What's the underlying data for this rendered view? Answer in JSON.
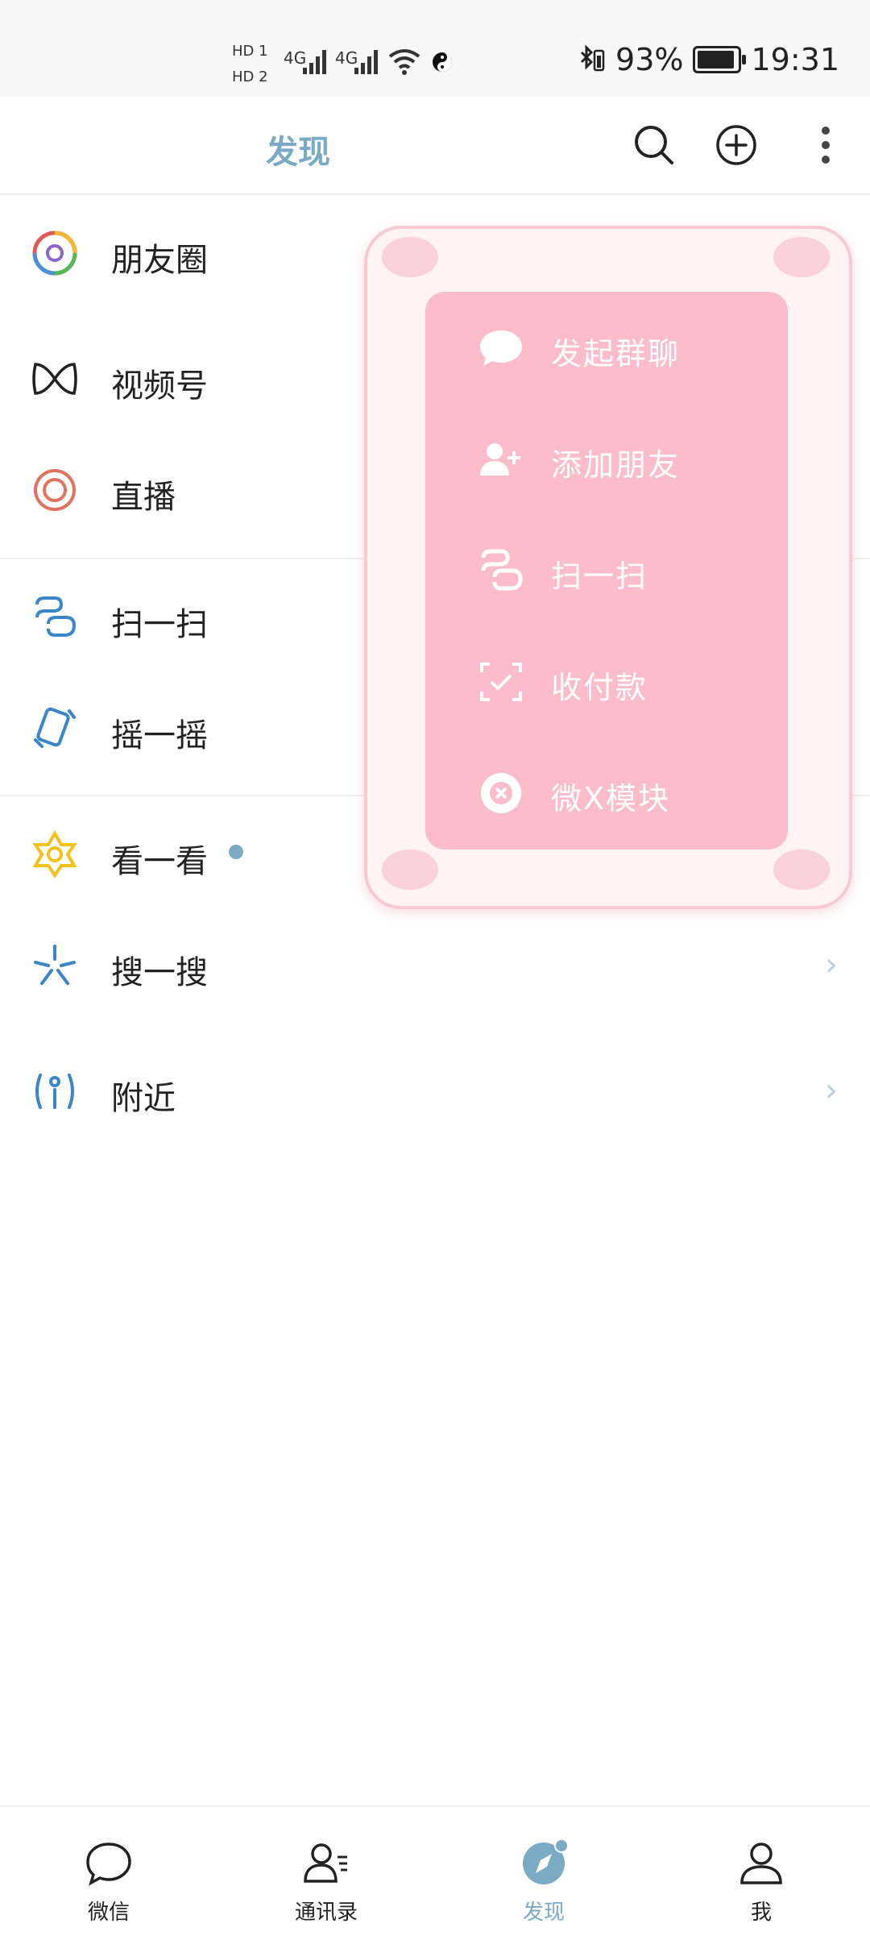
{
  "status_bar": {
    "sim1": "HD 1",
    "sim2": "HD 2",
    "signal1": "4G",
    "signal2": "4G",
    "battery_percent": "93%",
    "time": "19:31"
  },
  "header": {
    "title": "发现",
    "search_icon": "search-icon",
    "add_icon": "plus-circle-icon",
    "more_icon": "more-vertical-icon"
  },
  "list": {
    "moments": "朋友圈",
    "channels": "视频号",
    "live": "直播",
    "scan": "扫一扫",
    "shake": "摇一摇",
    "top_stories": "看一看",
    "search": "搜一搜",
    "nearby": "附近"
  },
  "popup_menu": {
    "items": [
      {
        "label": "发起群聊",
        "icon": "chat-bubble-icon"
      },
      {
        "label": "添加朋友",
        "icon": "add-user-icon"
      },
      {
        "label": "扫一扫",
        "icon": "scan-icon"
      },
      {
        "label": "收付款",
        "icon": "payment-icon"
      },
      {
        "label": "微X模块",
        "icon": "close-circle-icon"
      }
    ]
  },
  "tabbar": {
    "chats": "微信",
    "contacts": "通讯录",
    "discover": "发现",
    "me": "我"
  },
  "colors": {
    "accent": "#7aaac4",
    "popup_pink": "#fdbccb",
    "popup_frame": "#fff3f5"
  }
}
